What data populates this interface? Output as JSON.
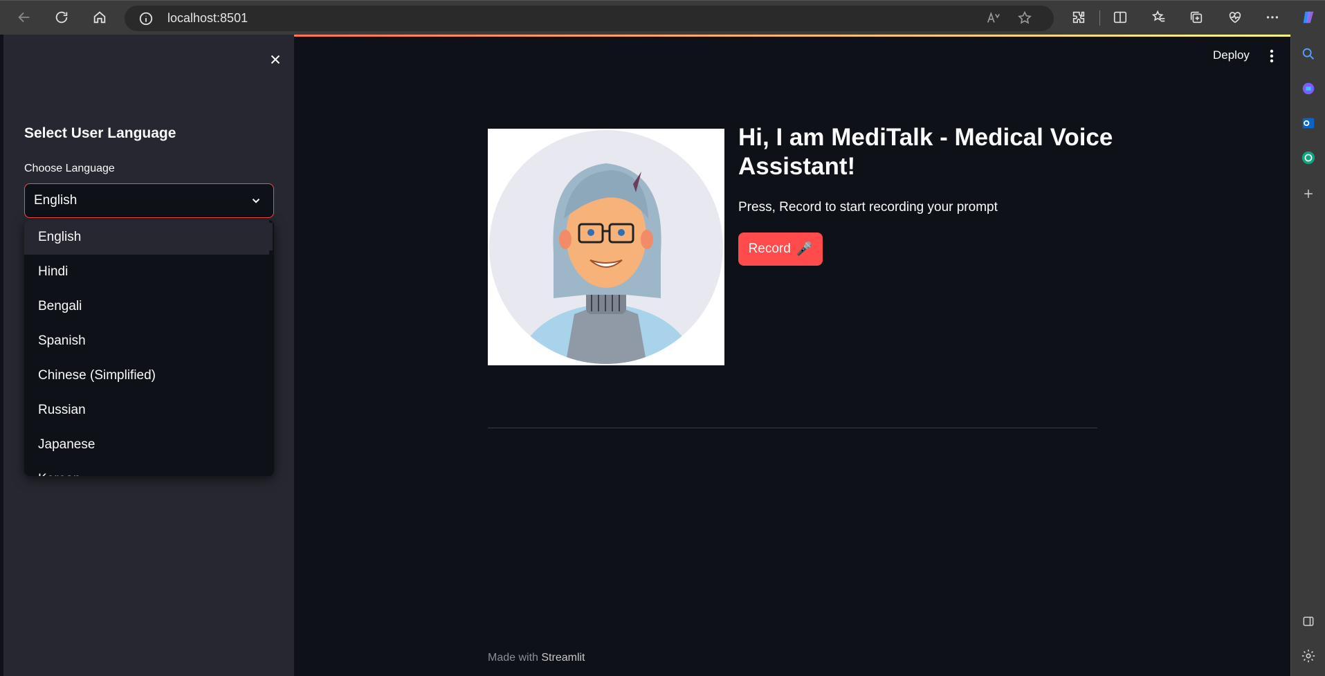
{
  "browser": {
    "url": "localhost:8501",
    "icons": {
      "back": "back-arrow-icon",
      "refresh": "refresh-icon",
      "home": "home-icon",
      "site_info": "info-icon",
      "read_aloud": "read-aloud-icon",
      "favorite": "star-icon",
      "extensions": "extensions-icon",
      "split_screen": "split-screen-icon",
      "favorites": "favorites-icon",
      "collections": "collections-icon",
      "browser_essentials": "heart-pulse-icon",
      "more": "more-horizontal-icon",
      "copilot": "copilot-icon"
    }
  },
  "edge_sidebar": {
    "icons": [
      "search-icon",
      "copilot-sidebar-icon",
      "outlook-icon",
      "chatgpt-icon",
      "add-icon",
      "sidebar-toggle-icon",
      "settings-icon"
    ]
  },
  "app": {
    "header": {
      "deploy_label": "Deploy"
    },
    "sidebar": {
      "title": "Select User Language",
      "select_label": "Choose Language",
      "selected_value": "English",
      "options": [
        "English",
        "Hindi",
        "Bengali",
        "Spanish",
        "Chinese (Simplified)",
        "Russian",
        "Japanese",
        "Korean"
      ]
    },
    "main": {
      "heading": "Hi, I am MediTalk - Medical Voice Assistant!",
      "subtext": "Press, Record to start recording your prompt",
      "record_label": "Record",
      "record_icon": "🎤"
    },
    "footer": {
      "prefix": "Made with",
      "brand": "Streamlit"
    }
  },
  "colors": {
    "primary": "#ff4b4b",
    "background": "#0e1117",
    "sidebar_bg": "#262730",
    "text": "#fafafa"
  }
}
